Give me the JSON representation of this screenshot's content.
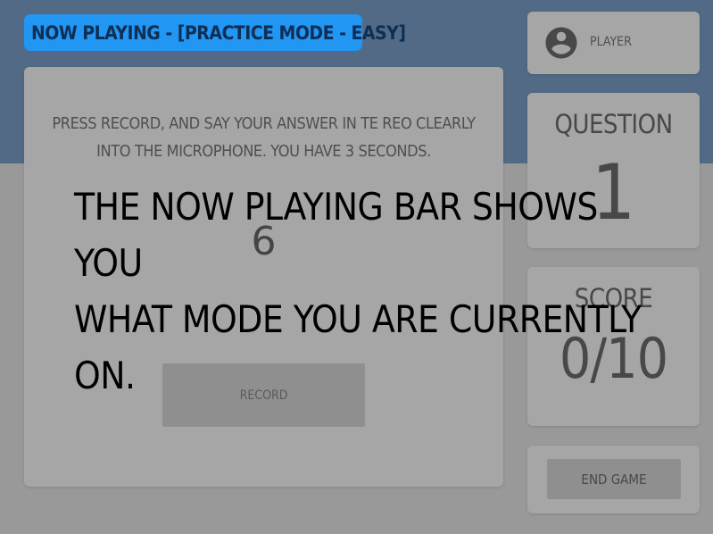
{
  "now_playing": {
    "label": "Now Playing - [Practice Mode - Easy]"
  },
  "player": {
    "name": "Player",
    "icon": "account-circle-icon"
  },
  "main": {
    "instructions_line1": "Press record, and say your answer in Te Reo clearly",
    "instructions_line2": "into the microphone. You have 3 seconds.",
    "word": "6",
    "record_label": "Record"
  },
  "question": {
    "label": "Question",
    "value": "1"
  },
  "score": {
    "label": "Score",
    "value": "0/10"
  },
  "end_game": {
    "label": "End Game"
  },
  "tutorial": {
    "line1": "The Now Playing bar shows you",
    "line2": "what mode you are currently on."
  },
  "colors": {
    "header_bg": "#7ea4cc",
    "page_bg": "#ececec",
    "now_playing_bg": "#2196f3",
    "now_playing_text": "#0e2f55"
  }
}
